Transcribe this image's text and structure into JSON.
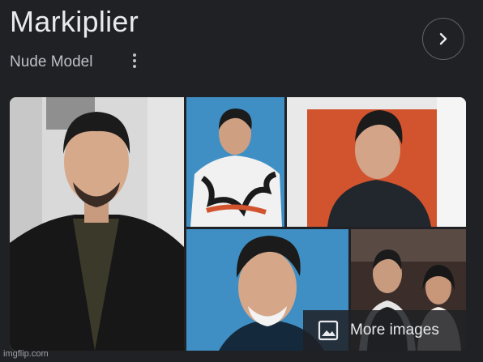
{
  "panel": {
    "title": "Markiplier",
    "subtitle": "Nude Model",
    "next_icon": "chevron-right-icon",
    "more_icon": "kebab-menu-icon"
  },
  "images": {
    "photos": [
      {
        "alt": "Photo 1"
      },
      {
        "alt": "Photo 2"
      },
      {
        "alt": "Photo 3"
      },
      {
        "alt": "Photo 4"
      },
      {
        "alt": "Photo 5"
      }
    ],
    "more_label": "More images",
    "more_icon": "image-icon"
  },
  "watermark": "imgflip.com",
  "colors": {
    "background": "#202124",
    "title": "#e8eaed",
    "subtitle": "#bdc1c6",
    "tile_blue": "#3f8fc4",
    "tile_orange": "#d2542f"
  }
}
